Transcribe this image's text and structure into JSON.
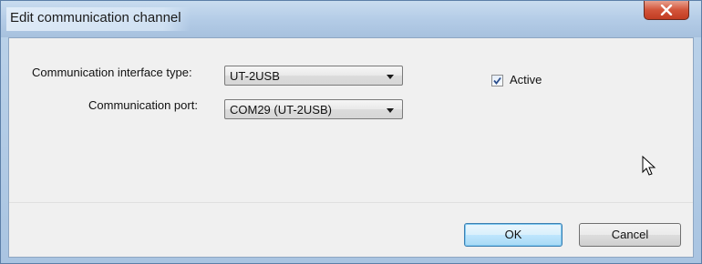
{
  "window": {
    "title": "Edit communication channel"
  },
  "form": {
    "interface_type_label": "Communication interface type:",
    "interface_type_value": "UT-2USB",
    "port_label": "Communication port:",
    "port_value": "COM29 (UT-2USB)",
    "active_label": "Active",
    "active_checked": true
  },
  "buttons": {
    "ok_label": "OK",
    "cancel_label": "Cancel"
  },
  "icons": {
    "close": "close-icon",
    "dropdown": "chevron-down-icon",
    "check": "checkmark-icon",
    "cursor": "mouse-pointer-icon"
  },
  "colors": {
    "titlebar": "#b3cbe6",
    "close_button": "#c94a30",
    "client_background": "#f0f0f0",
    "default_button_border": "#3c7fb1"
  }
}
